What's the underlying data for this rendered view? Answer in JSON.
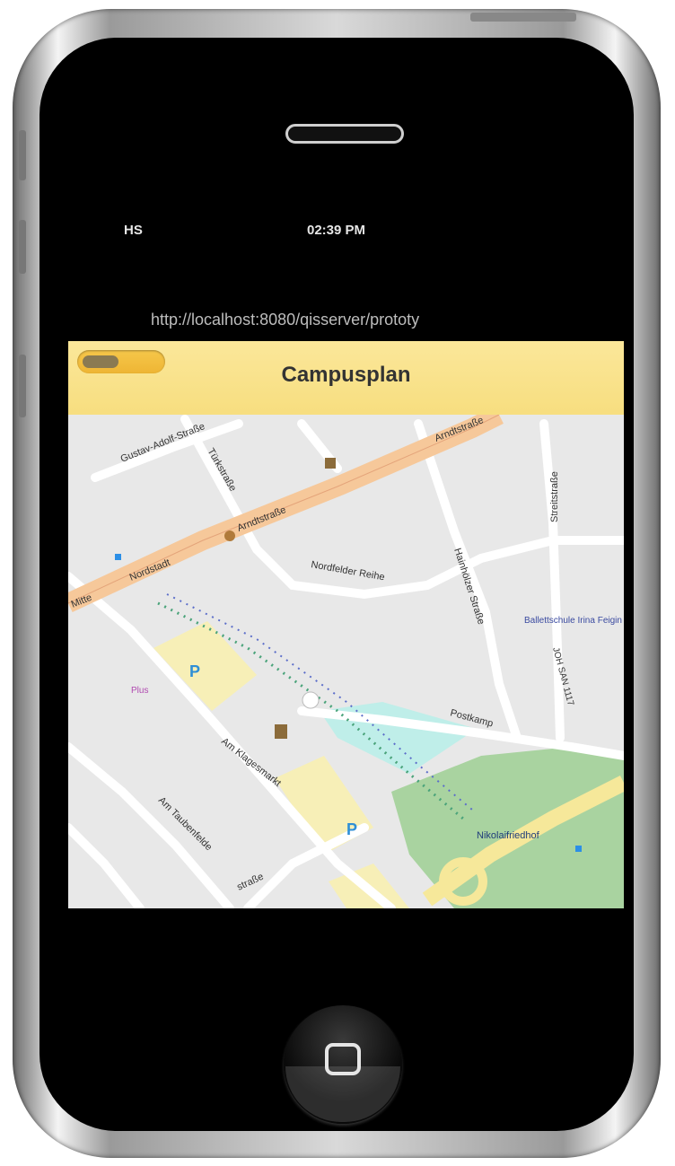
{
  "status_bar": {
    "carrier": "HS",
    "time": "02:39 PM"
  },
  "url_bar": {
    "url": "http://localhost:8080/qisserver/prototy"
  },
  "header": {
    "title": "Campusplan"
  },
  "map": {
    "streets": [
      "Gustav-Adolf-Straße",
      "Türkstraße",
      "Arndtstraße",
      "Arndtstraße",
      "Nordfelder Reihe",
      "Nordstadt",
      "Mitte",
      "Hainhölzer Straße",
      "Streitstraße",
      "Postkamp",
      "Am Klagesmarkt",
      "Am Taubenfelde",
      "Nikolaifriedhof",
      "Ballettschule Irina Feigin",
      "Plus",
      "JOH SAN 1117",
      "straße"
    ],
    "parking_label": "P"
  }
}
